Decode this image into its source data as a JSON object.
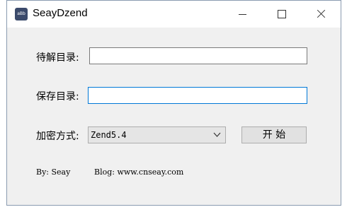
{
  "window": {
    "title": "SeayDzend",
    "icon_name": "seaydzend-app-icon",
    "icon_text": "aBb"
  },
  "form": {
    "decrypt_dir_label": "待解目录:",
    "decrypt_dir_value": "",
    "save_dir_label": "保存目录:",
    "save_dir_value": "",
    "encrypt_method_label": "加密方式:",
    "encrypt_method_selected": "Zend5.4",
    "start_button_label": "开 始"
  },
  "footer": {
    "by_text": "By: Seay",
    "blog_text": "Blog: www.cnseay.com"
  },
  "colors": {
    "focus_border": "#0078d7",
    "window_bg": "#f0f0f0",
    "titlebar_bg": "#ffffff"
  }
}
